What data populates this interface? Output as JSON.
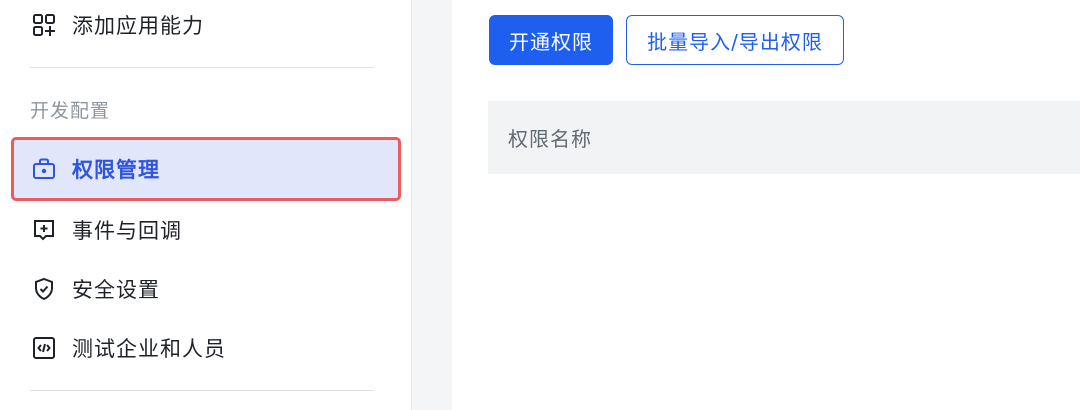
{
  "sidebar": {
    "top_item": {
      "label": "添加应用能力",
      "icon": "add-grid-icon"
    },
    "section_title": "开发配置",
    "items": [
      {
        "label": "权限管理",
        "icon": "briefcase-icon",
        "active": true
      },
      {
        "label": "事件与回调",
        "icon": "plus-square-icon",
        "active": false
      },
      {
        "label": "安全设置",
        "icon": "shield-check-icon",
        "active": false
      },
      {
        "label": "测试企业和人员",
        "icon": "code-square-icon",
        "active": false
      }
    ]
  },
  "toolbar": {
    "primary_label": "开通权限",
    "secondary_label": "批量导入/导出权限"
  },
  "table": {
    "columns": [
      "权限名称"
    ]
  },
  "colors": {
    "accent": "#1f5ff0",
    "active_bg": "#e1e6fb",
    "highlight_outline": "#ee5a5f"
  }
}
